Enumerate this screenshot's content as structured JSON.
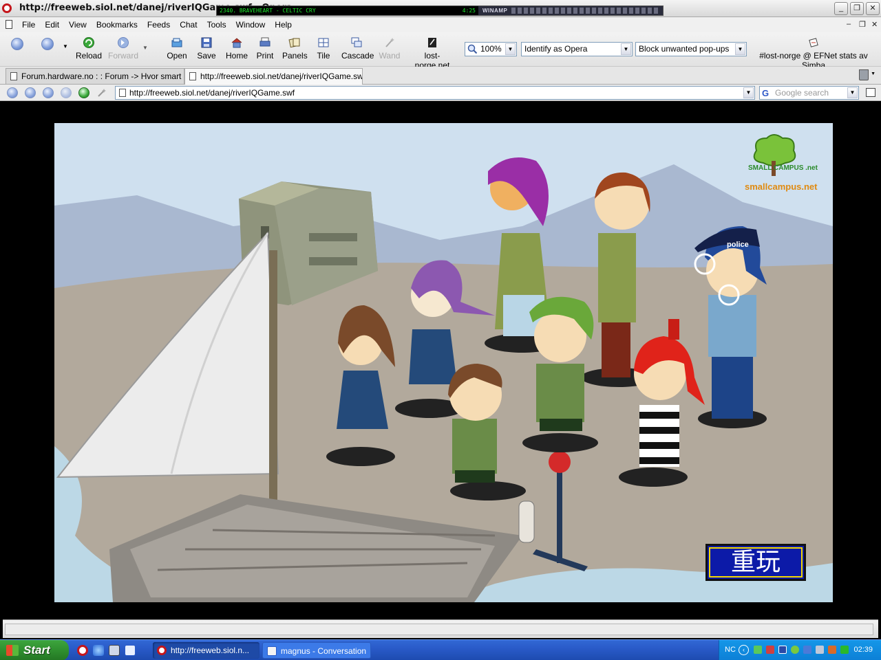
{
  "window": {
    "title": "http://freeweb.siol.net/danej/riverIQGame.swf - Opera",
    "minimize": "_",
    "maximize": "❐",
    "close": "✕"
  },
  "winamp": {
    "track": "2340. BRAVEHEART - CELTIC CRY",
    "time": "4:25",
    "label": "WINAMP"
  },
  "menu": {
    "items": [
      "File",
      "Edit",
      "View",
      "Bookmarks",
      "Feeds",
      "Chat",
      "Tools",
      "Window",
      "Help"
    ]
  },
  "toolbar": {
    "reload": "Reload",
    "forward": "Forward",
    "open": "Open",
    "save": "Save",
    "home": "Home",
    "print": "Print",
    "panels": "Panels",
    "tile": "Tile",
    "cascade": "Cascade",
    "wand": "Wand",
    "lostnorge": "lost-norge.net",
    "zoom": "100%",
    "identify": "Identify as Opera",
    "popups": "Block unwanted pop-ups",
    "irc": "#lost-norge @ EFNet stats av Simba"
  },
  "tabs": [
    {
      "label": "Forum.hardware.no : : Forum -> Hvor smart ..."
    },
    {
      "label": "http://freeweb.siol.net/danej/riverIQGame.swf"
    }
  ],
  "address": {
    "url": "http://freeweb.siol.net/danej/riverIQGame.swf",
    "search_placeholder": "Google search",
    "search_logo": "G"
  },
  "game": {
    "brand_text": "smallcampus.net",
    "logo_text": "SMALL CAMPUS .net",
    "police_label": "police",
    "replay_label": "重玩"
  },
  "taskbar": {
    "start": "Start",
    "tasks": [
      {
        "label": "http://freeweb.siol.n..."
      },
      {
        "label": "magnus - Conversation"
      }
    ],
    "lang": "NC",
    "clock": "02:39"
  },
  "colors": {
    "sky": "#cfe0ef",
    "ground": "#b2a99c",
    "water": "#bcd8e6",
    "replay_bg": "#0c1aa8",
    "replay_border": "#f4d800"
  }
}
